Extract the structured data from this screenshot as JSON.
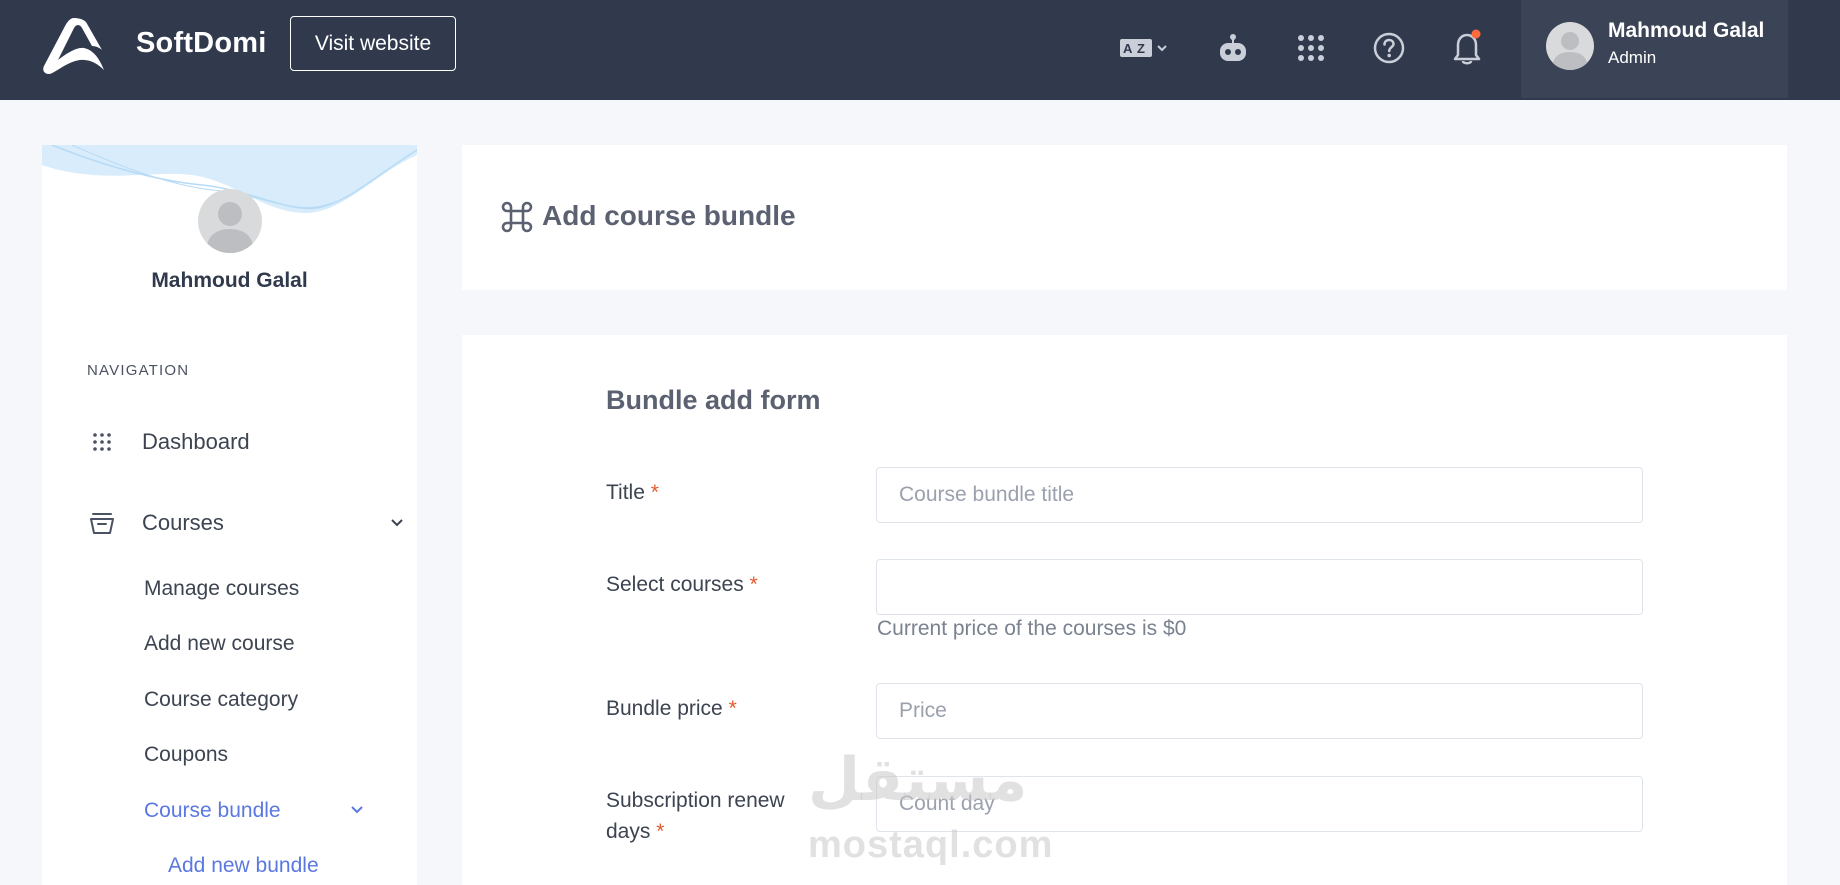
{
  "topbar": {
    "brand": "SoftDomi",
    "visit_button": "Visit website",
    "icons": [
      "logo-icon",
      "language-icon",
      "robot-icon",
      "apps-grid-icon",
      "help-icon",
      "bell-icon"
    ],
    "notification_dot_color": "#ff6b3d",
    "user": {
      "name": "Mahmoud Galal",
      "role": "Admin"
    }
  },
  "sidebar": {
    "profile_name": "Mahmoud Galal",
    "nav_heading": "NAVIGATION",
    "items": [
      {
        "label": "Dashboard",
        "icon": "dashboard-grid-icon"
      },
      {
        "label": "Courses",
        "icon": "courses-icon",
        "expanded": true
      }
    ],
    "course_subitems": [
      {
        "label": "Manage courses"
      },
      {
        "label": "Add new course"
      },
      {
        "label": "Course category"
      },
      {
        "label": "Coupons"
      },
      {
        "label": "Course bundle",
        "active": true,
        "expanded": true
      }
    ],
    "bundle_subitems": [
      {
        "label": "Add new bundle",
        "active": true
      }
    ],
    "accent_color": "#5a78e0"
  },
  "page": {
    "title": "Add course bundle",
    "title_icon": "command-icon"
  },
  "form": {
    "title": "Bundle add form",
    "required_mark": "*",
    "fields": {
      "title": {
        "label": "Title",
        "placeholder": "Course bundle title",
        "value": ""
      },
      "courses": {
        "label": "Select courses",
        "placeholder": "",
        "value": "",
        "help": "Current price of the courses is $0"
      },
      "price": {
        "label": "Bundle price",
        "placeholder": "Price",
        "value": ""
      },
      "renew": {
        "label_line1": "Subscription renew",
        "label_line2": "days",
        "placeholder": "Count day",
        "value": ""
      }
    }
  },
  "watermark": {
    "arabic": "مستقل",
    "latin": "mostaql.com"
  }
}
